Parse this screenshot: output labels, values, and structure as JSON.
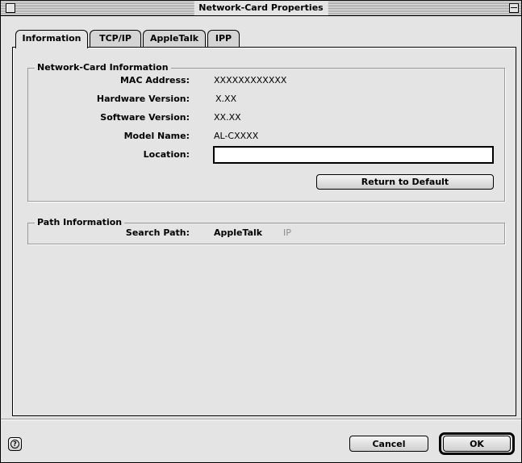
{
  "window": {
    "title": "Network-Card Properties"
  },
  "tabs": [
    {
      "label": "Information",
      "active": true
    },
    {
      "label": "TCP/IP",
      "active": false
    },
    {
      "label": "AppleTalk",
      "active": false
    },
    {
      "label": "IPP",
      "active": false
    }
  ],
  "network_card": {
    "group_label": "Network-Card Information",
    "mac_label": "MAC Address:",
    "mac_value": "XXXXXXXXXXXX",
    "hw_label": "Hardware Version:",
    "hw_value": "X.XX",
    "sw_label": "Software Version:",
    "sw_value": "XX.XX",
    "model_label": "Model Name:",
    "model_value": "AL-CXXXX",
    "location_label": "Location:",
    "location_value": "",
    "return_default_label": "Return to Default"
  },
  "path": {
    "group_label": "Path Information",
    "search_label": "Search Path:",
    "option_appletalk": "AppleTalk",
    "option_ip": "IP"
  },
  "footer": {
    "help_glyph": "?",
    "cancel_label": "Cancel",
    "ok_label": "OK"
  },
  "colors": {
    "window_bg": "#e4e4e4",
    "disabled_text": "#8c8c8c"
  }
}
